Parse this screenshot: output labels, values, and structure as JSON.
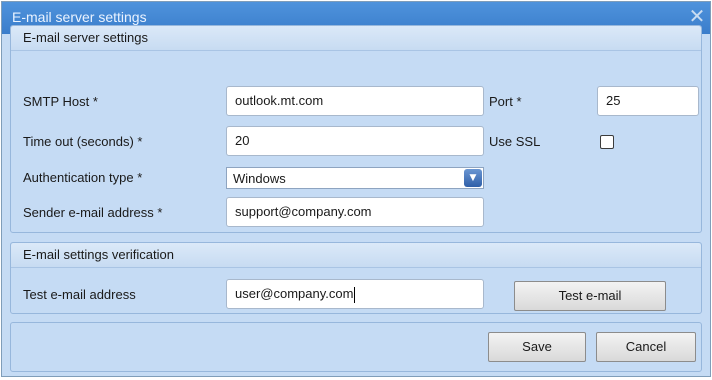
{
  "window": {
    "title": "E-mail server settings",
    "close_glyph": "✕"
  },
  "server_group": {
    "header": "E-mail server settings",
    "smtp_host_label": "SMTP Host *",
    "smtp_host_value": "outlook.mt.com",
    "port_label": "Port *",
    "port_value": "25",
    "timeout_label": "Time out (seconds) *",
    "timeout_value": "20",
    "use_ssl_label": "Use SSL",
    "use_ssl_checked": false,
    "auth_label": "Authentication type *",
    "auth_value": "Windows",
    "sender_label": "Sender e-mail address *",
    "sender_value": "support@company.com"
  },
  "verify_group": {
    "header": "E-mail settings verification",
    "test_label": "Test e-mail address",
    "test_value": "user@company.com",
    "test_button": "Test e-mail"
  },
  "footer": {
    "save_label": "Save",
    "cancel_label": "Cancel"
  }
}
